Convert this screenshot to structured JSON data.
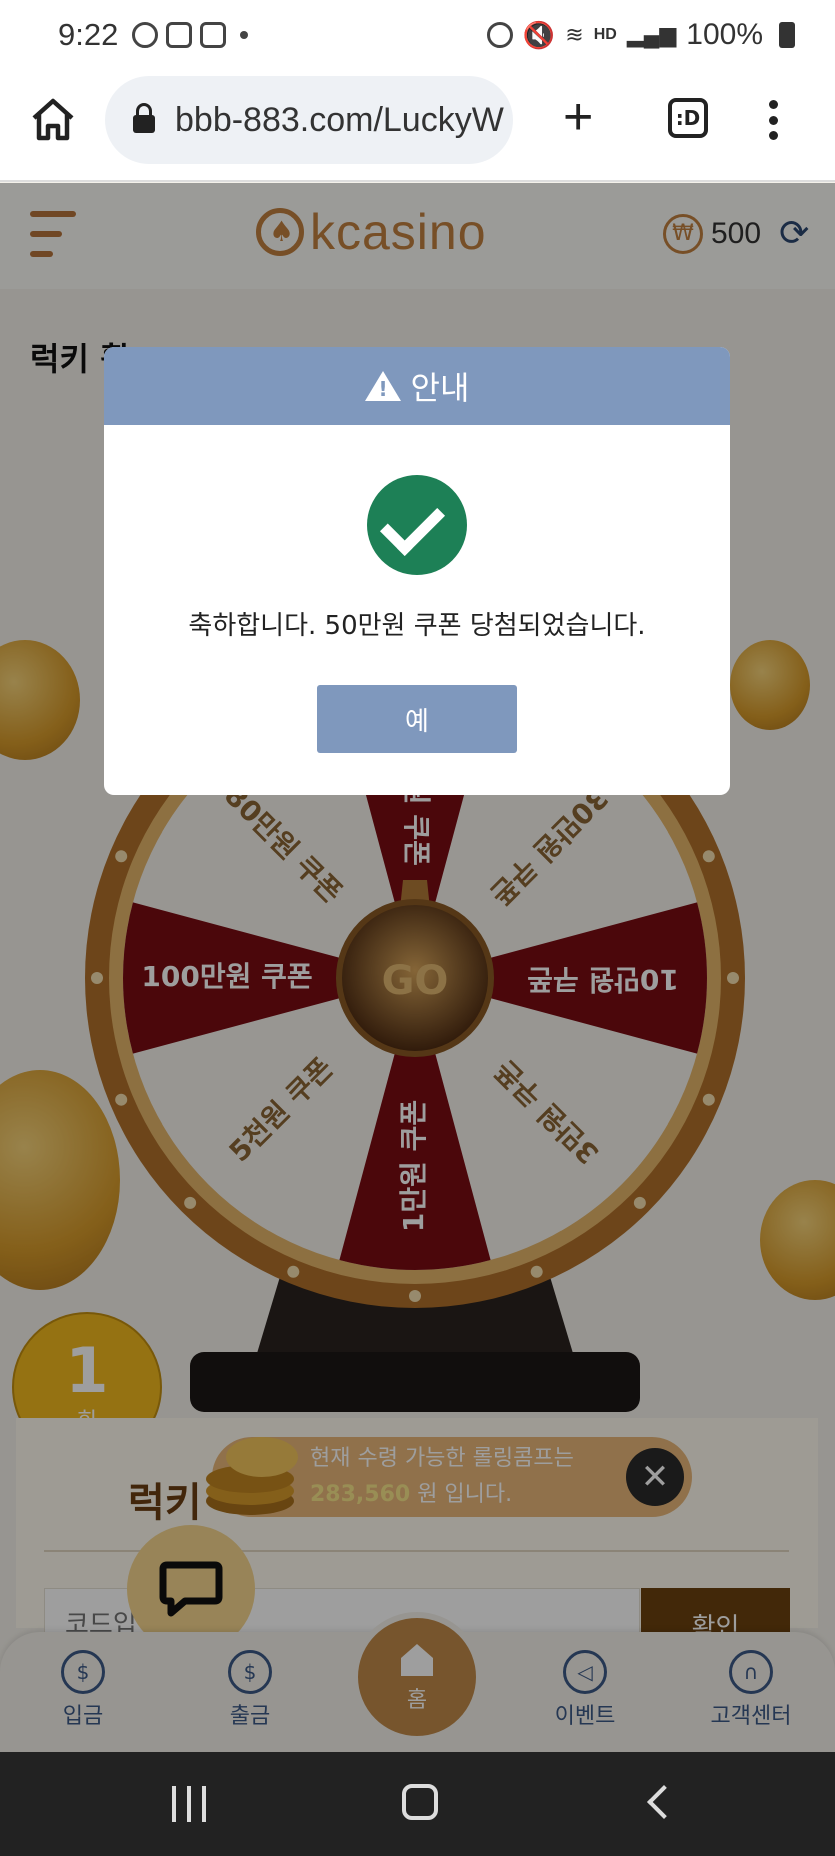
{
  "status_bar": {
    "time": "9:22",
    "battery": "100%",
    "network": "HD"
  },
  "browser": {
    "url": "bbb-883.com/LuckyW",
    "tabs_label": ":D"
  },
  "site": {
    "logo_text": "kcasino",
    "balance": "500",
    "currency_symbol": "₩",
    "page_title": "럭키 휠"
  },
  "wheel": {
    "center_label": "GO",
    "segments": [
      "50만원 쿠폰",
      "30만원 쿠폰",
      "10만원 쿠폰",
      "3만원 쿠폰",
      "1만원 쿠폰",
      "5천원 쿠폰",
      "100만원 쿠폰",
      "80만원 쿠폰"
    ],
    "colors": {
      "red": "#7a0c12",
      "white": "#f5f2ec",
      "rim": "#b0702a",
      "text_red": "#ffffff",
      "text_white": "#8a6434"
    }
  },
  "spin_count": {
    "value": "1",
    "unit": "회"
  },
  "lower": {
    "title": "럭키",
    "code_placeholder": "코드입력",
    "confirm_label": "확인"
  },
  "toast": {
    "line1": "현재 수령 가능한 롤링콤프는",
    "amount": "283,560",
    "line2_suffix": " 원 입니다.",
    "close": "✕"
  },
  "bottom_nav": {
    "deposit": "입금",
    "withdraw": "출금",
    "home": "홈",
    "event": "이벤트",
    "support": "고객센터"
  },
  "dialog": {
    "title": "안내",
    "message": "축하합니다. 50만원 쿠폰 당첨되었습니다.",
    "ok_label": "예"
  },
  "colors": {
    "dialog_header": "#7f98bd",
    "success_green": "#1d8056",
    "brand_gold": "#c0803f"
  }
}
